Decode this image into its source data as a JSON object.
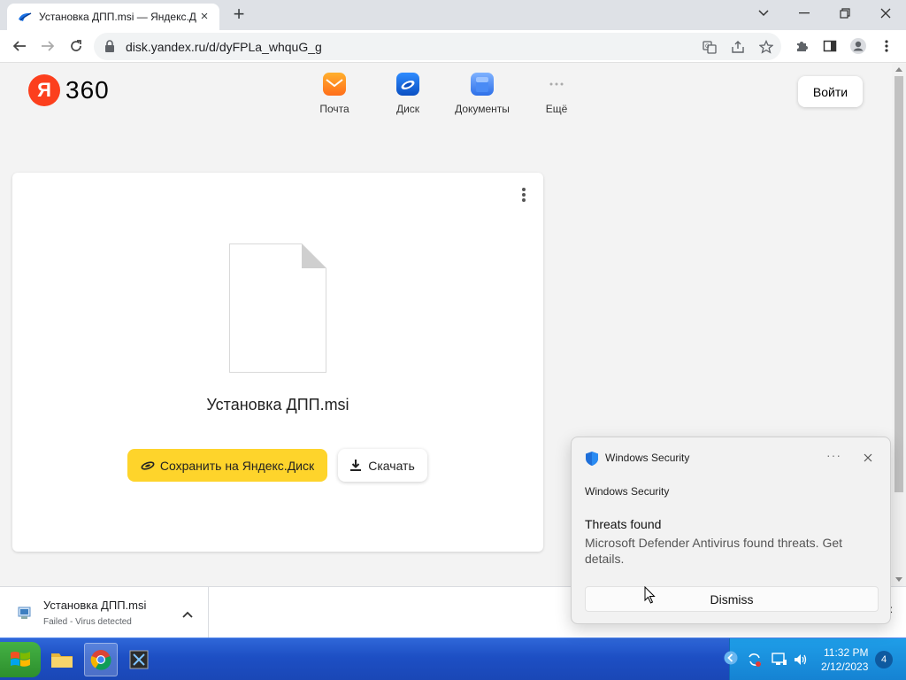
{
  "browser": {
    "tab": {
      "title": "Установка ДПП.msi — Яндекс.Д",
      "favicon": "yandex-disk-icon",
      "close": "×"
    },
    "new_tab": "+",
    "url": "disk.yandex.ru/d/dyFPLa_whquG_g"
  },
  "header": {
    "logo_ya": "Я",
    "logo_360": "360",
    "services": [
      {
        "label": "Почта",
        "icon": "mail-icon",
        "color": "#ff8a1a"
      },
      {
        "label": "Диск",
        "icon": "disk-icon",
        "color": "#1a73e8"
      },
      {
        "label": "Документы",
        "icon": "documents-icon",
        "color": "#3b82f6"
      },
      {
        "label": "Ещё",
        "icon": "more-dots-icon",
        "color": "#b0b0b0"
      }
    ],
    "login": "Войти"
  },
  "file_card": {
    "file_name": "Установка ДПП.msi",
    "save_label": "Сохранить на Яндекс.Диск",
    "download_label": "Скачать",
    "accent": "#fed42b"
  },
  "download_shelf": {
    "file_name": "Установка ДПП.msi",
    "status": "Failed - Virus detected",
    "close": "×"
  },
  "toast": {
    "app_name": "Windows Security",
    "more": "···",
    "source": "Windows Security",
    "title": "Threats found",
    "body": "Microsoft Defender Antivirus found threats. Get details.",
    "dismiss": "Dismiss"
  },
  "taskbar": {
    "time": "11:32 PM",
    "date": "2/12/2023",
    "notifications": "4"
  }
}
